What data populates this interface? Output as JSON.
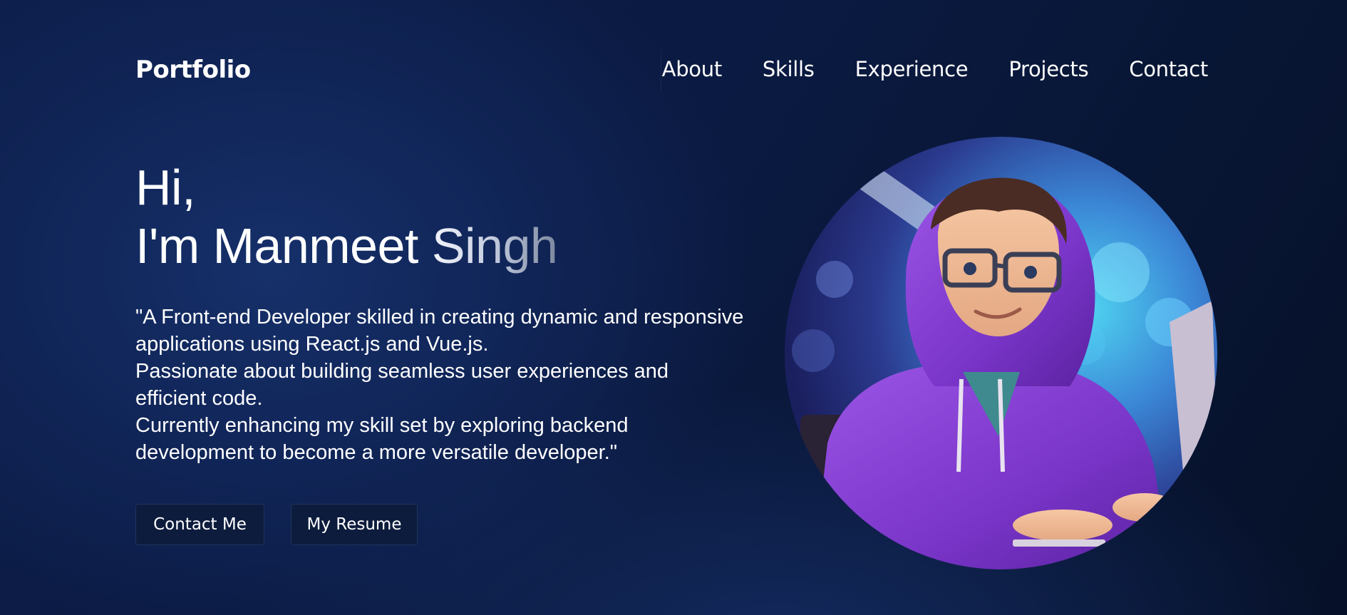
{
  "nav": {
    "logo": "Portfolio",
    "links": [
      "About",
      "Skills",
      "Experience",
      "Projects",
      "Contact"
    ]
  },
  "hero": {
    "greeting": "Hi,",
    "intro_prefix": "I'm Manmeet ",
    "intro_fade": "Singh",
    "description": [
      "\"A Front-end Developer skilled in creating dynamic and responsive",
      "applications using React.js and Vue.js.",
      "Passionate about building seamless user experiences and",
      "efficient code.",
      "Currently enhancing my skill set by exploring backend",
      "development to become a more versatile developer.\""
    ],
    "buttons": {
      "contact": "Contact Me",
      "resume": "My Resume"
    }
  },
  "colors": {
    "background": "#0b1a42",
    "button_bg": "#0d1c3d",
    "hoodie": "#7a35c9",
    "text": "#ffffff"
  }
}
